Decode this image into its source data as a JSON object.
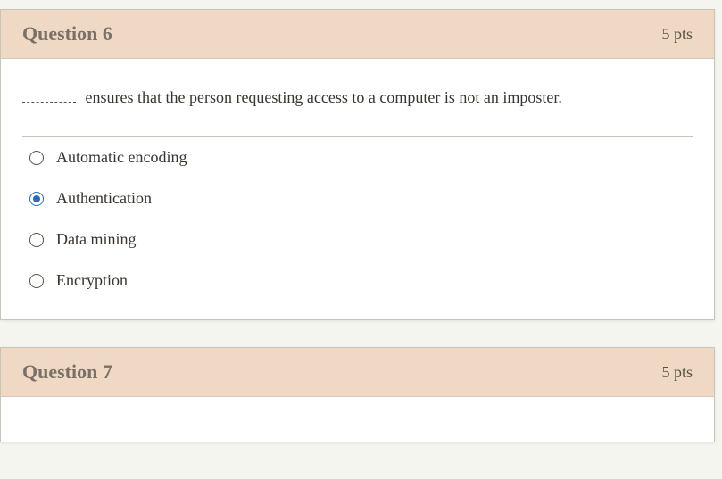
{
  "questions": [
    {
      "title": "Question 6",
      "points": "5 pts",
      "text": "ensures that the person requesting access to a computer is not an imposter.",
      "options": [
        {
          "label": "Automatic encoding",
          "selected": false
        },
        {
          "label": "Authentication",
          "selected": true
        },
        {
          "label": "Data mining",
          "selected": false
        },
        {
          "label": "Encryption",
          "selected": false
        }
      ]
    },
    {
      "title": "Question 7",
      "points": "5 pts"
    }
  ]
}
